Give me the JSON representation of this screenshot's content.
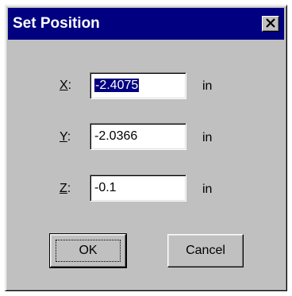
{
  "window": {
    "title": "Set Position"
  },
  "fields": [
    {
      "label_key": "X",
      "label_rest": ":",
      "value": "-2.4075",
      "unit": "in",
      "selected": true
    },
    {
      "label_key": "Y",
      "label_rest": ":",
      "value": "-2.0366",
      "unit": "in",
      "selected": false
    },
    {
      "label_key": "Z",
      "label_rest": ":",
      "value": "-0.1",
      "unit": "in",
      "selected": false
    }
  ],
  "buttons": {
    "ok_label": "OK",
    "cancel_label": "Cancel"
  },
  "icons": {
    "close": "close-icon"
  },
  "colors": {
    "titlebar": "#000080",
    "face": "#c0c0c0",
    "selection": "#000080"
  }
}
